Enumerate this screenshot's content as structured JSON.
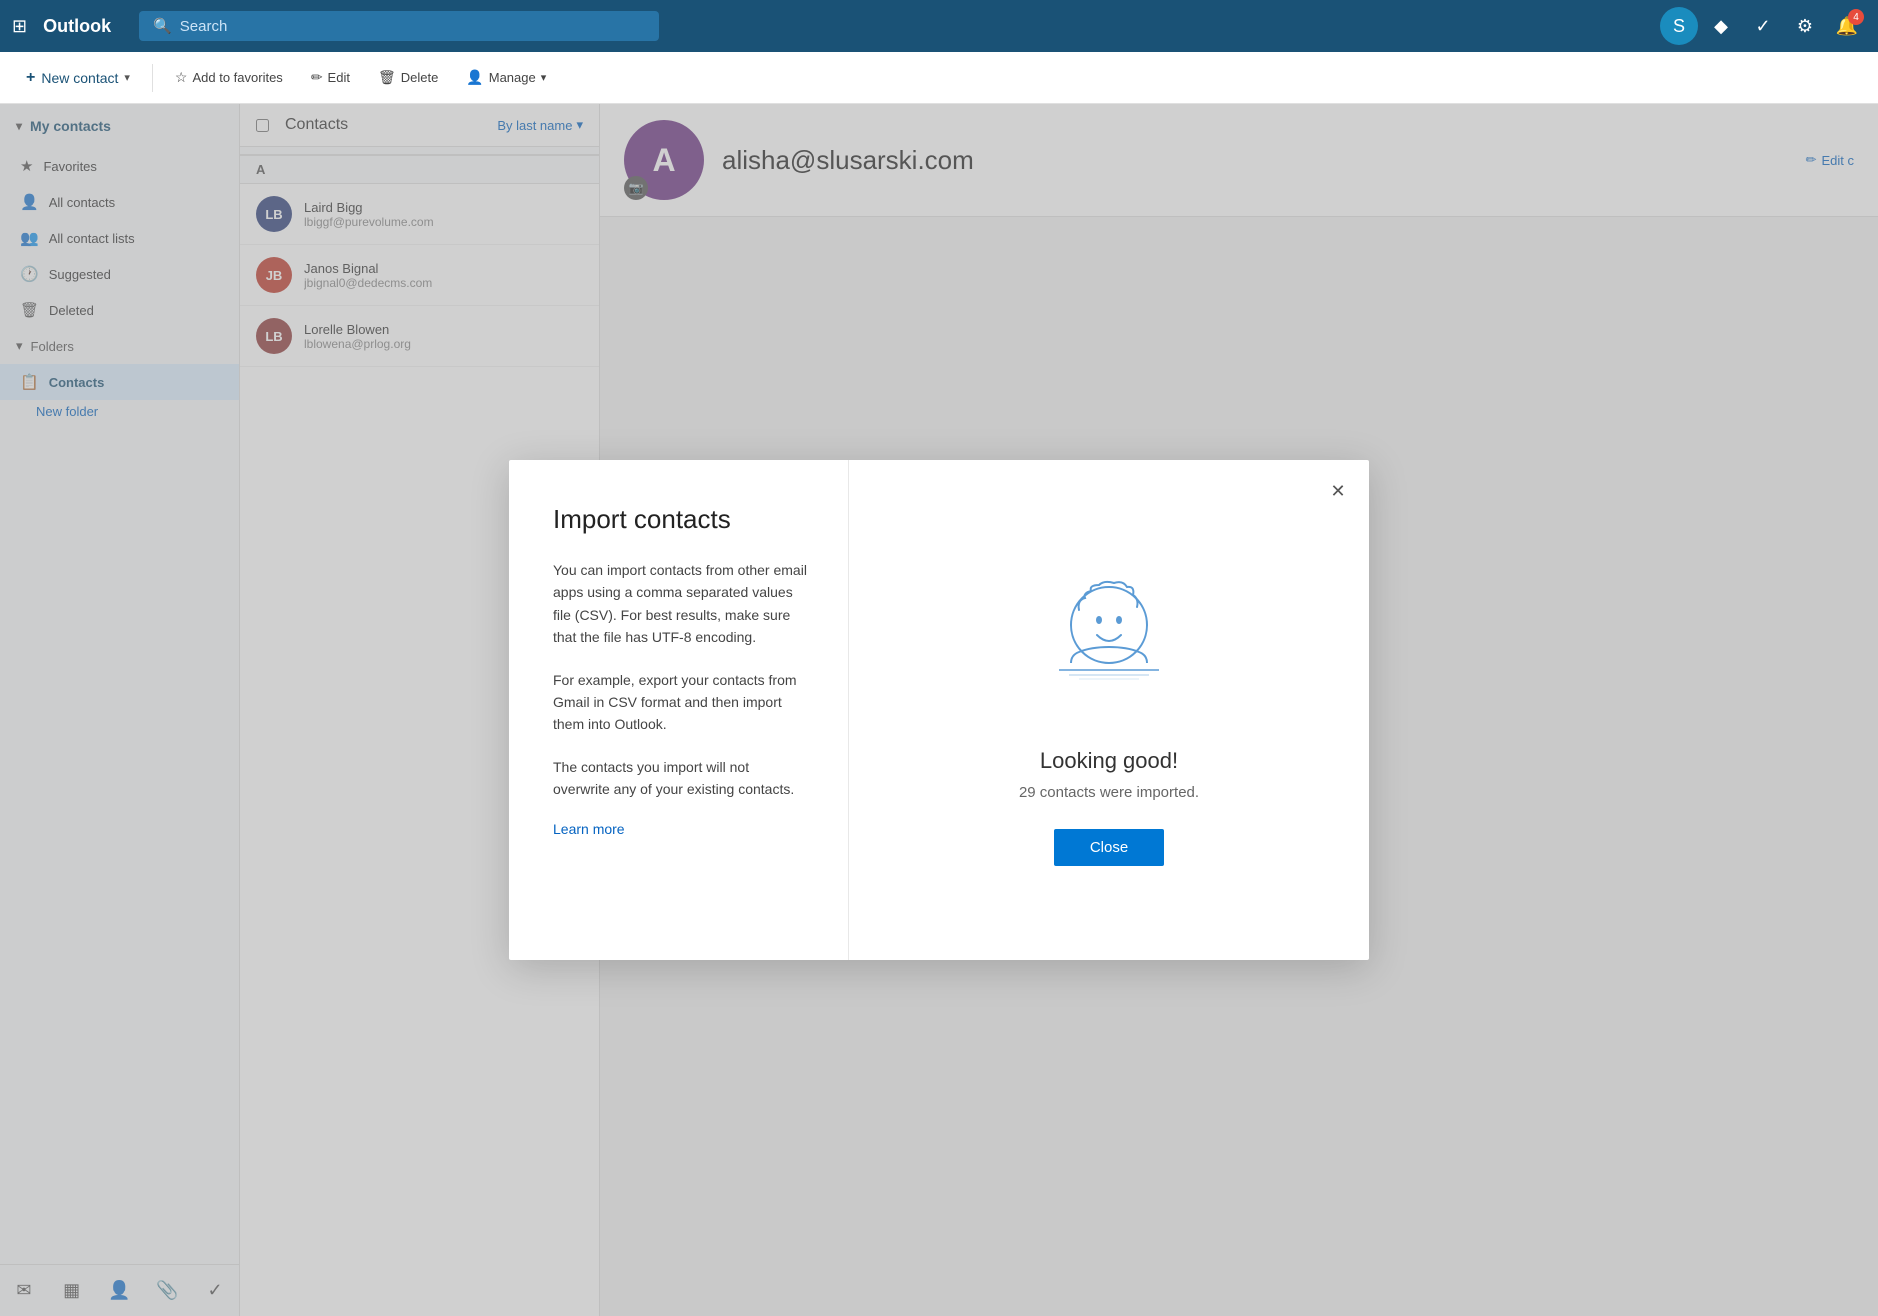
{
  "topbar": {
    "logo": "Outlook",
    "search_placeholder": "Search",
    "notification_badge": "4",
    "icons": {
      "skype": "S",
      "diamond": "◆",
      "checkmark": "✓",
      "settings": "⚙",
      "notifications": "🔔"
    }
  },
  "actionbar": {
    "new_contact_label": "New contact",
    "add_favorites_label": "Add to favorites",
    "edit_label": "Edit",
    "delete_label": "Delete",
    "manage_label": "Manage"
  },
  "sidebar": {
    "my_contacts_label": "My contacts",
    "favorites_label": "Favorites",
    "all_contacts_label": "All contacts",
    "all_contact_lists_label": "All contact lists",
    "suggested_label": "Suggested",
    "deleted_label": "Deleted",
    "folders_label": "Folders",
    "contacts_label": "Contacts",
    "new_folder_label": "New folder"
  },
  "contact_list": {
    "title": "Contacts",
    "sort_label": "By last name",
    "section_a": "A",
    "contacts": [
      {
        "initials": "LB",
        "name": "Laird Bigg",
        "email": "lbiggf@purevolume.com",
        "color": "#2c3e7a"
      },
      {
        "initials": "JB",
        "name": "Janos Bignal",
        "email": "jbignal0@dedecms.com",
        "color": "#c0392b"
      },
      {
        "initials": "LB",
        "name": "Lorelle Blowen",
        "email": "lblowena@prlog.org",
        "color": "#8e3a3a"
      }
    ]
  },
  "detail": {
    "avatar_letter": "A",
    "email": "alisha@slusarski.com",
    "edit_label": "Edit c"
  },
  "modal": {
    "title": "Import contacts",
    "body1": "You can import contacts from other email apps using a comma separated values file (CSV). For best results, make sure that the file has UTF-8 encoding.",
    "body2": "For example, export your contacts from Gmail in CSV format and then import them into Outlook.",
    "body3": "The contacts you import will not overwrite any of your existing contacts.",
    "learn_more_label": "Learn more",
    "success_title": "Looking good!",
    "success_sub": "29 contacts were imported.",
    "close_btn_label": "Close",
    "close_icon": "✕"
  },
  "bottom_nav": {
    "mail_icon": "✉",
    "calendar_icon": "▦",
    "contacts_icon": "👤",
    "attach_icon": "📎",
    "tasks_icon": "✓"
  }
}
